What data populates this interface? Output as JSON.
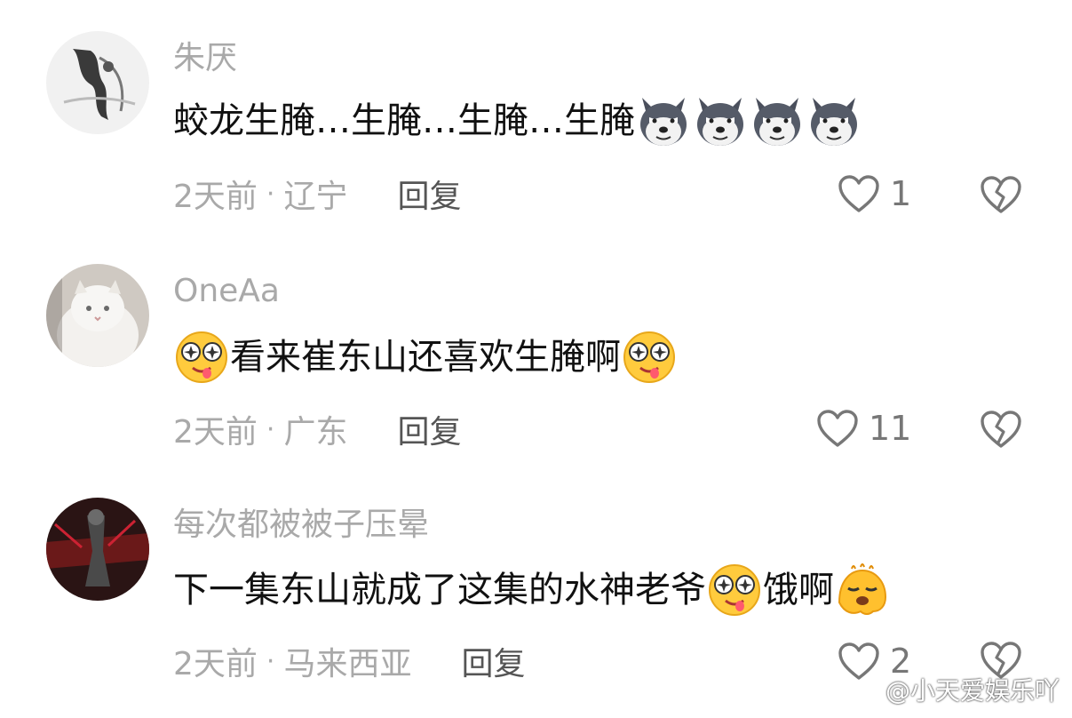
{
  "comments": [
    {
      "username": "朱厌",
      "text": "蛟龙生腌…生腌…生腌…生腌",
      "trailing_emojis": [
        "husky-emoji",
        "husky-emoji",
        "husky-emoji",
        "husky-emoji"
      ],
      "time": "2天前",
      "location": "辽宁",
      "reply_label": "回复",
      "likes": "1"
    },
    {
      "username": "OneAa",
      "leading_emoji": "drooling-emoji",
      "text": "看来崔东山还喜欢生腌啊",
      "trailing_emoji": "drooling-emoji",
      "time": "2天前",
      "location": "广东",
      "reply_label": "回复",
      "likes": "11"
    },
    {
      "username": "每次都被被子压晕",
      "text": "下一集东山就成了这集的水神老爷",
      "mid_emoji": "drooling-emoji",
      "text2": "饿啊",
      "trailing_emoji": "melting-emoji",
      "time": "2天前",
      "location": "马来西亚",
      "reply_label": "回复",
      "likes": "2"
    }
  ],
  "separator": "·",
  "watermark": "@小天爱娱乐吖",
  "colors": {
    "muted": "#a9a9a9",
    "text": "#111111",
    "icon": "#777777"
  }
}
